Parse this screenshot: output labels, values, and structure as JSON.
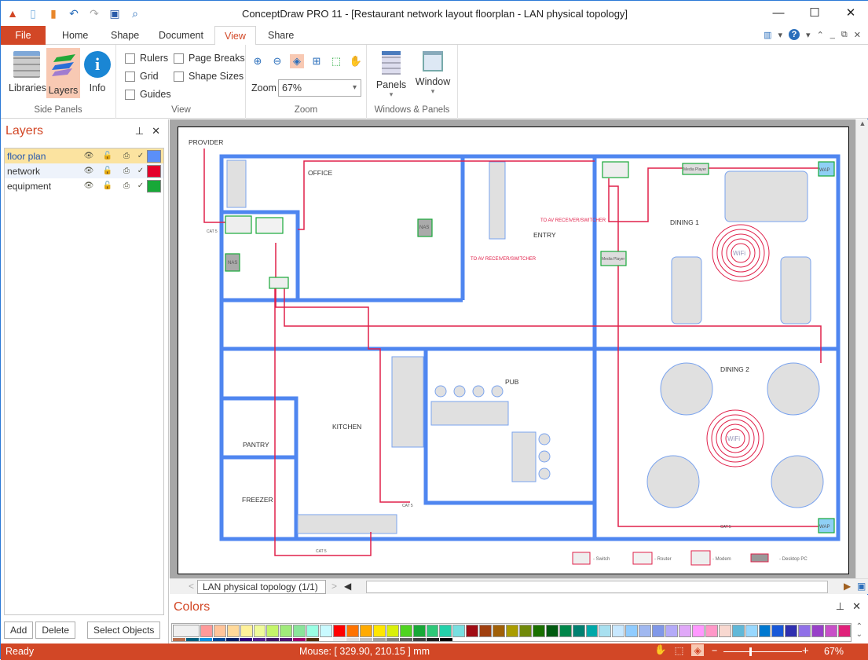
{
  "app": {
    "title": "ConceptDraw PRO 11 - [Restaurant network layout floorplan - LAN physical topology]",
    "window_controls": [
      "minimize",
      "maximize",
      "close"
    ]
  },
  "quick_access": [
    "app-logo",
    "new-document",
    "open",
    "undo",
    "redo",
    "save",
    "print-preview"
  ],
  "tabs": [
    {
      "label": "File"
    },
    {
      "label": "Home"
    },
    {
      "label": "Shape"
    },
    {
      "label": "Document"
    },
    {
      "label": "View",
      "active": true
    },
    {
      "label": "Share"
    }
  ],
  "ribbon": {
    "side_panels": {
      "label": "Side Panels",
      "buttons": [
        {
          "label": "Libraries"
        },
        {
          "label": "Layers",
          "selected": true
        },
        {
          "label": "Info"
        }
      ]
    },
    "view": {
      "label": "View",
      "checkboxes": [
        {
          "label": "Rulers",
          "checked": false
        },
        {
          "label": "Page Breaks",
          "checked": false
        },
        {
          "label": "Grid",
          "checked": false
        },
        {
          "label": "Shape Sizes",
          "checked": false
        },
        {
          "label": "Guides",
          "checked": false
        }
      ]
    },
    "zoom": {
      "label": "Zoom",
      "field_label": "Zoom",
      "value": "67%",
      "tools": [
        "zoom-in",
        "zoom-out",
        "fit-to-page",
        "zoom-to-selection",
        "zoom-area",
        "pan"
      ]
    },
    "windows_panels": {
      "label": "Windows & Panels",
      "buttons": [
        {
          "label": "Panels"
        },
        {
          "label": "Window"
        }
      ]
    }
  },
  "layers_panel": {
    "title": "Layers",
    "layers": [
      {
        "name": "floor plan",
        "color": "#5b8ff9",
        "visible": true,
        "selected": true
      },
      {
        "name": "network",
        "color": "#e4002b",
        "visible": true
      },
      {
        "name": "equipment",
        "color": "#18a838",
        "visible": true
      }
    ],
    "buttons": {
      "add": "Add",
      "delete": "Delete",
      "select_objects": "Select Objects"
    }
  },
  "canvas": {
    "labels": {
      "provider": "PROVIDER",
      "office": "OFFICE",
      "entry": "ENTRY",
      "dining1": "DINING 1",
      "dining2": "DINING 2",
      "kitchen": "KITCHEN",
      "pub": "PUB",
      "pantry": "PANTRY",
      "freezer": "FREEZER",
      "wifi": "WiFi",
      "wap": "WAP",
      "nas": "NAS",
      "media_player": "Media Player",
      "cat5": "CAT 5",
      "av": "TO AV RECEIVER/SWITCHER"
    },
    "legend": [
      {
        "label": "- Switch"
      },
      {
        "label": "- Router"
      },
      {
        "label": "- Modem"
      },
      {
        "label": "- Desktop PC"
      }
    ]
  },
  "page_nav": {
    "current": "LAN physical topology (1/1)"
  },
  "colors_panel": {
    "title": "Colors",
    "row1": [
      "#ff9a9a",
      "#ffc49a",
      "#ffd99a",
      "#fff19a",
      "#effa9a",
      "#c4f56a",
      "#a0ea7a",
      "#8ae49a",
      "#9affe4",
      "#c9faff",
      "#ff0000",
      "#ff7300",
      "#ffaa00",
      "#ffe600",
      "#d9f00a",
      "#4fd420",
      "#18a838",
      "#2ec878",
      "#24d1aa",
      "#78dfe0",
      "#a00c14",
      "#a04010",
      "#a06008",
      "#aa9c00",
      "#70890a",
      "#1a7000",
      "#005a10",
      "#00864a",
      "#008070",
      "#00a8a8",
      "#a8e0f0",
      "#c8e8ff",
      "#90ccff",
      "#a0b8f0",
      "#8098e8",
      "#b4aaf8",
      "#e0a8f8",
      "#ff98ff",
      "#ff98c8",
      "#f8d8d0",
      "#60b8d8",
      "#98d8ff",
      "#0078d0",
      "#1858d8",
      "#3030b0",
      "#9070e8",
      "#9840c8",
      "#c850c8",
      "#e0207a"
    ],
    "row2": [
      "#b87050",
      "#006080",
      "#1090e0",
      "#004a98",
      "#002068",
      "#30007a",
      "#50208a",
      "#401868",
      "#501870",
      "#980068",
      "#503010",
      "#ffffff",
      "#f0f0f0",
      "#dcdcdc",
      "#c0c0c0",
      "#a0a0a0",
      "#808080",
      "#606060",
      "#404040",
      "#202020",
      "#000000"
    ]
  },
  "status": {
    "left": "Ready",
    "mouse": "Mouse: [ 329.90, 210.15 ] mm",
    "zoom": "67%",
    "zoom_slider_fraction": 0.33
  }
}
